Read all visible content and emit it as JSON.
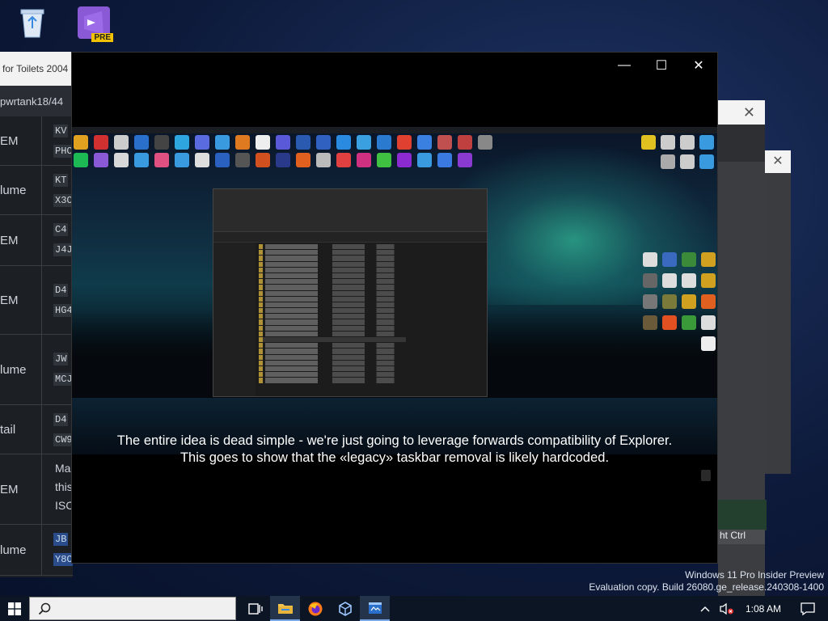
{
  "desktop": {
    "icons": [
      {
        "name": "recycle-bin",
        "label": "Recycle Bin"
      },
      {
        "name": "visual-studio-preview",
        "label": "Visual Studio",
        "badge": "PRE"
      }
    ]
  },
  "background_window": {
    "title_fragment": "for Toilets 2004",
    "url_fragment": "pwrtank18/44",
    "rows": [
      {
        "c1": "EM",
        "c2": [
          "KV",
          "PHC"
        ]
      },
      {
        "c1": "lume",
        "c2": [
          "KT",
          "X3C"
        ]
      },
      {
        "c1": "EM",
        "c2": [
          "C4",
          "J4J"
        ]
      },
      {
        "c1": "EM",
        "c2": [
          "D4",
          "HG4"
        ]
      },
      {
        "c1": "lume",
        "c2": [
          "JW",
          "MCJ"
        ]
      },
      {
        "c1": "tail",
        "c2": [
          "D4",
          "CW9"
        ]
      },
      {
        "c1": "EM",
        "c2": [
          "Ma",
          "this",
          "ISC"
        ]
      },
      {
        "c1": "lume",
        "c2": [
          "JB",
          "Y8C"
        ]
      }
    ]
  },
  "right_window": {
    "close_label": "✕",
    "status_text": "ht Ctrl"
  },
  "video_window": {
    "controls": {
      "minimize": "—",
      "maximize": "☐",
      "close": "✕"
    },
    "subtitle_line1": "The entire idea is dead simple - we're just going to leverage forwards compatibility of Explorer.",
    "subtitle_line2": "This goes to show that the «legacy» taskbar removal is likely hardcoded."
  },
  "watermark": {
    "line1": "Windows 11 Pro Insider Preview",
    "line2": "Evaluation copy. Build 26080.ge_release.240308-1400"
  },
  "taskbar": {
    "search_placeholder": "",
    "apps": [
      "task-view",
      "file-explorer",
      "firefox",
      "virtualbox",
      "app-window"
    ],
    "clock": "1:08 AM"
  },
  "colors": {
    "taskbar": "#0b1524",
    "accent": "#7aa7e6",
    "desktop": "#0d1a3a"
  }
}
